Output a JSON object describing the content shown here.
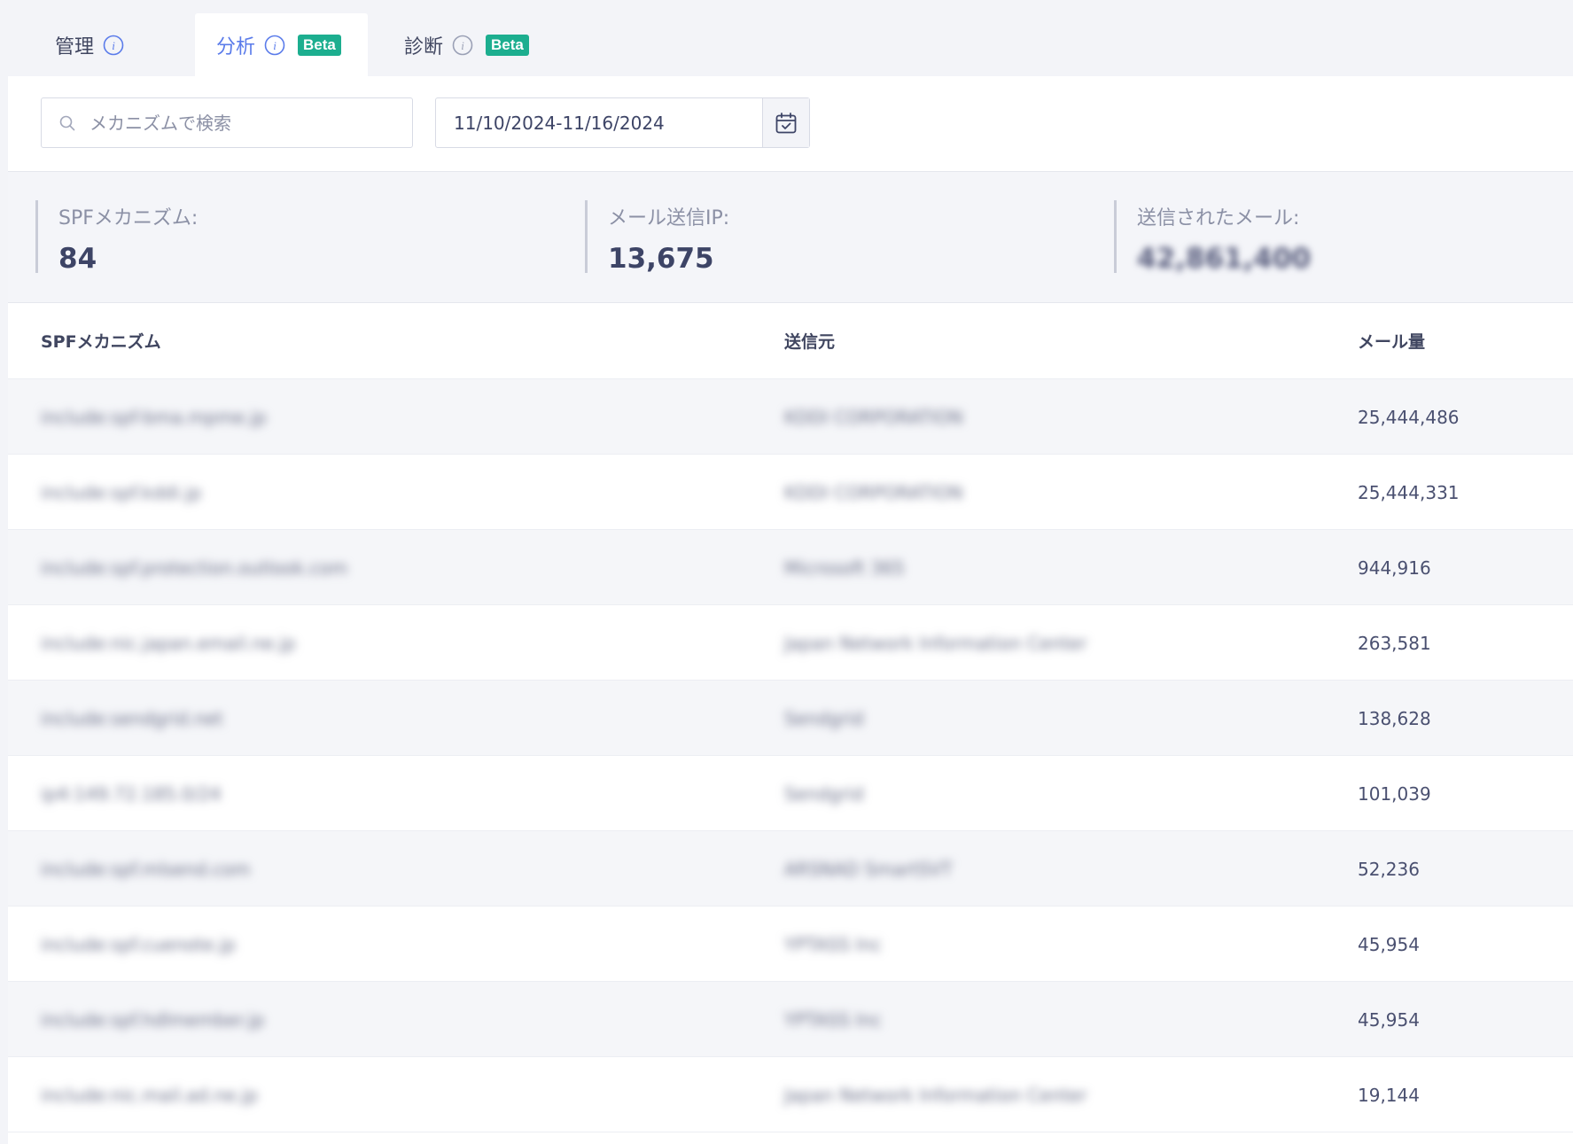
{
  "tabs": [
    {
      "label": "管理",
      "info_icon": "info-icon",
      "badge": null,
      "active": false
    },
    {
      "label": "分析",
      "info_icon": "info-icon",
      "badge": "Beta",
      "active": true
    },
    {
      "label": "診断",
      "info_icon": "info-icon",
      "badge": "Beta",
      "active": false
    }
  ],
  "filters": {
    "search_placeholder": "メカニズムで検索",
    "search_icon": "search-icon",
    "date_range": "11/10/2024-11/16/2024",
    "calendar_icon": "calendar-icon"
  },
  "stats": {
    "spf_label": "SPFメカニズム:",
    "spf_value": "84",
    "ip_label": "メール送信IP:",
    "ip_value": "13,675",
    "sent_label": "送信されたメール:",
    "sent_value": "42,861,400"
  },
  "table": {
    "headers": {
      "mechanism": "SPFメカニズム",
      "sender": "送信元",
      "volume": "メール量"
    },
    "rows": [
      {
        "mechanism": "include:spf-bma.mpme.jp",
        "sender": "KDDI CORPORATION",
        "volume": "25,444,486"
      },
      {
        "mechanism": "include:spf.kddi.jp",
        "sender": "KDDI CORPORATION",
        "volume": "25,444,331"
      },
      {
        "mechanism": "include:spf.protection.outlook.com",
        "sender": "Microsoft 365",
        "volume": "944,916"
      },
      {
        "mechanism": "include:nic.japan.email.ne.jp",
        "sender": "Japan Network Information Center",
        "volume": "263,581"
      },
      {
        "mechanism": "include:sendgrid.net",
        "sender": "Sendgrid",
        "volume": "138,628"
      },
      {
        "mechanism": "ip4:149.72.185.0/24",
        "sender": "Sendgrid",
        "volume": "101,039"
      },
      {
        "mechanism": "include:spf.mlsend.com",
        "sender": "ARSNAD SmartSVT",
        "volume": "52,236"
      },
      {
        "mechanism": "include:spf.cuenote.jp",
        "sender": "YPTASS Inc",
        "volume": "45,954"
      },
      {
        "mechanism": "include:spf.hdlmember.jp",
        "sender": "YPTASS Inc",
        "volume": "45,954"
      },
      {
        "mechanism": "include:nic.mail.ad.ne.jp",
        "sender": "Japan Network Information Center",
        "volume": "19,144"
      }
    ]
  },
  "colors": {
    "accent": "#5a7bea",
    "badge": "#1cae8f",
    "text": "#3d4466"
  }
}
